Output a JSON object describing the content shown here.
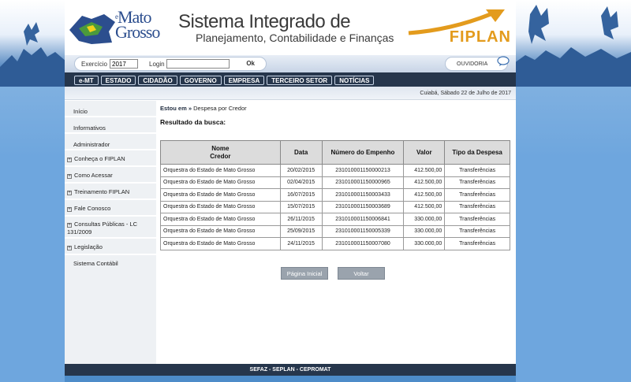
{
  "header": {
    "logo_mato": "Mato",
    "logo_e": "e",
    "logo_grosso": "Grosso",
    "title_line1": "Sistema Integrado de",
    "title_line2": "Planejamento, Contabilidade e Finanças",
    "brand": "FIPLAN",
    "brand_color": "#e39b1d"
  },
  "login": {
    "exercicio_label": "Exercício",
    "exercicio_value": "2017",
    "login_label": "Login",
    "login_value": "",
    "ok_label": "Ok",
    "ouvidoria_label": "OUVIDORIA"
  },
  "nav": {
    "items": [
      "e-MT",
      "ESTADO",
      "CIDADÃO",
      "GOVERNO",
      "EMPRESA",
      "TERCEIRO SETOR",
      "NOTÍCIAS"
    ]
  },
  "datebar": {
    "text": "Cuiabá, Sábado 22 de Julho de 2017"
  },
  "sidebar": {
    "items": [
      {
        "label": "Início",
        "expandable": false
      },
      {
        "label": "Informativos",
        "expandable": false
      },
      {
        "label": "Administrador",
        "expandable": false
      },
      {
        "label": "Conheça o FIPLAN",
        "expandable": true
      },
      {
        "label": "Como Acessar",
        "expandable": true
      },
      {
        "label": "Treinamento FIPLAN",
        "expandable": true
      },
      {
        "label": "Fale Conosco",
        "expandable": true
      },
      {
        "label": "Consultas Públicas - LC 131/2009",
        "expandable": true
      },
      {
        "label": "Legislação",
        "expandable": true
      },
      {
        "label": "Sistema Contábil",
        "expandable": false
      }
    ]
  },
  "content": {
    "crumb_prefix": "Estou em »",
    "crumb_page": "Despesa por Credor",
    "result_title": "Resultado da busca:",
    "table": {
      "headers": [
        "Nome\nCredor",
        "Data",
        "Número do Empenho",
        "Valor",
        "Tipo da Despesa"
      ],
      "rows": [
        [
          "Orquestra do Estado de Mato Grosso",
          "20/02/2015",
          "231010001150000213",
          "412.500,00",
          "Transferências"
        ],
        [
          "Orquestra do Estado de Mato Grosso",
          "02/04/2015",
          "231010001150000965",
          "412.500,00",
          "Transferências"
        ],
        [
          "Orquestra do Estado de Mato Grosso",
          "16/07/2015",
          "231010001150003433",
          "412.500,00",
          "Transferências"
        ],
        [
          "Orquestra do Estado de Mato Grosso",
          "15/07/2015",
          "231010001150003689",
          "412.500,00",
          "Transferências"
        ],
        [
          "Orquestra do Estado de Mato Grosso",
          "26/11/2015",
          "231010001150006841",
          "330.000,00",
          "Transferências"
        ],
        [
          "Orquestra do Estado de Mato Grosso",
          "25/09/2015",
          "231010001150005339",
          "330.000,00",
          "Transferências"
        ],
        [
          "Orquestra do Estado de Mato Grosso",
          "24/11/2015",
          "231010001150007080",
          "330.000,00",
          "Transferências"
        ]
      ]
    },
    "buttons": {
      "home": "Página Inicial",
      "back": "Voltar"
    }
  },
  "footer": {
    "text": "SEFAZ - SEPLAN - CEPROMAT"
  }
}
